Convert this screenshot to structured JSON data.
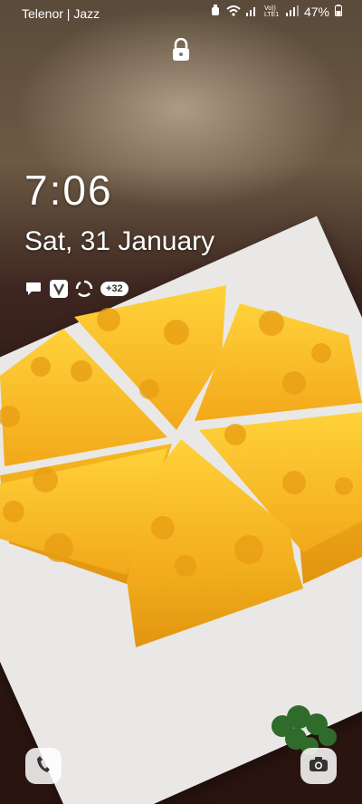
{
  "status_bar": {
    "carrier": "Telenor | Jazz",
    "battery": "47%",
    "volte_label": "Vo)) LTE1"
  },
  "lock_screen": {
    "time": "7:06",
    "date": "Sat, 31 January",
    "notification_badge": "+32"
  },
  "shortcuts": {
    "left_icon": "phone-icon",
    "right_icon": "camera-icon"
  }
}
